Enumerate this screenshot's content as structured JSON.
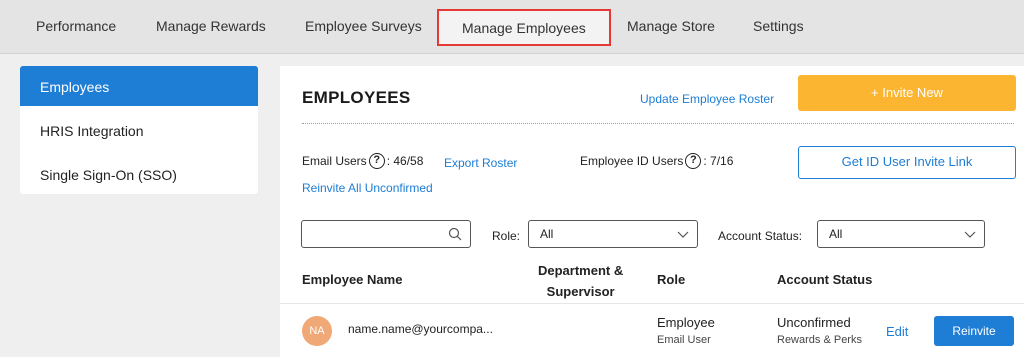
{
  "nav": {
    "tabs": [
      {
        "label": "Performance"
      },
      {
        "label": "Manage Rewards"
      },
      {
        "label": "Employee Surveys"
      },
      {
        "label": "Manage Employees"
      },
      {
        "label": "Manage Store"
      },
      {
        "label": "Settings"
      }
    ],
    "active_tab": "Manage Employees"
  },
  "sidebar": {
    "items": [
      {
        "label": "Employees"
      },
      {
        "label": "HRIS Integration"
      },
      {
        "label": "Single Sign-On (SSO)"
      }
    ],
    "active_item": "Employees"
  },
  "main": {
    "title": "EMPLOYEES",
    "update_roster_label": "Update Employee Roster",
    "invite_new_label": "+ Invite New",
    "email_users_label": "Email Users",
    "email_users_value": ": 46/58",
    "export_roster_label": "Export Roster",
    "reinvite_all_label": "Reinvite All Unconfirmed",
    "id_users_label": "Employee ID Users",
    "id_users_value": ": 7/16",
    "get_id_link_label": "Get ID User Invite Link",
    "help_glyph": "?",
    "search": {
      "value": "",
      "placeholder": ""
    },
    "role_filter": {
      "label": "Role:",
      "value": "All"
    },
    "status_filter": {
      "label": "Account Status:",
      "value": "All"
    },
    "columns": {
      "name": "Employee Name",
      "dept_line1": "Department &",
      "dept_line2": "Supervisor",
      "role": "Role",
      "status": "Account Status"
    },
    "rows": [
      {
        "initials": "NA",
        "email": "name.name@yourcompa...",
        "role": "Employee",
        "role_sub": "Email User",
        "status": "Unconfirmed",
        "status_sub": "Rewards & Perks",
        "edit_label": "Edit",
        "reinvite_label": "Reinvite"
      }
    ]
  },
  "colors": {
    "accent_blue": "#1e7dd4",
    "invite_orange": "#fbb531",
    "active_tab_border": "#e53935",
    "avatar_peach": "#f0a877"
  },
  "icons": {
    "search": "search-icon",
    "dropdown": "chevron-down-icon",
    "help": "help-circle-icon"
  }
}
